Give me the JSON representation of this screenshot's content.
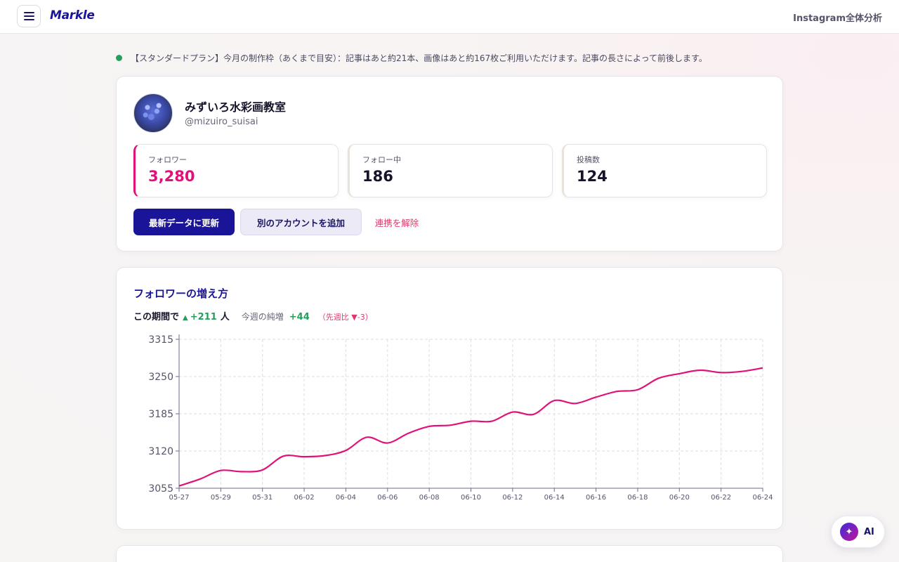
{
  "header": {
    "logo": "Markle",
    "right_title": "Instagram全体分析",
    "menu_icon": "hamburger-icon"
  },
  "notice": {
    "text": "【スタンダードプラン】今月の制作枠（あくまで目安）：記事はあと約21本、画像はあと約167枚ご利用いただけます。記事の長さによって前後します。",
    "status_color": "#22a05a"
  },
  "profile": {
    "name": "みずいろ水彩画教室",
    "handle": "@mizuiro_suisai",
    "stats": [
      {
        "label": "フォロワー",
        "value": "3,280"
      },
      {
        "label": "フォロー中",
        "value": "186"
      },
      {
        "label": "投稿数",
        "value": "124"
      }
    ],
    "buttons": {
      "refresh": "最新データに更新",
      "add_account": "別のアカウントを追加",
      "unlink": "連携を解除"
    }
  },
  "growth": {
    "title": "フォロワーの増え方",
    "period_label": "この期間で",
    "period_arrow": "▲",
    "period_amount": "+211",
    "period_unit": "人",
    "week_label": "今週の純増",
    "week_value": "+44",
    "compare": "（先週比 ▼-3）"
  },
  "colors": {
    "brand": "#1a1499",
    "accent": "#e0127a",
    "positive": "#22a05a",
    "negative": "#e0386a"
  },
  "chart_data": {
    "type": "line",
    "x": [
      "05-27",
      "05-28",
      "05-29",
      "05-30",
      "05-31",
      "06-01",
      "06-02",
      "06-03",
      "06-04",
      "06-05",
      "06-06",
      "06-07",
      "06-08",
      "06-09",
      "06-10",
      "06-11",
      "06-12",
      "06-13",
      "06-14",
      "06-15",
      "06-16",
      "06-17",
      "06-18",
      "06-19",
      "06-20",
      "06-21",
      "06-22",
      "06-23",
      "06-24"
    ],
    "x_tick_labels": [
      "05-27",
      "05-29",
      "05-31",
      "06-02",
      "06-04",
      "06-06",
      "06-08",
      "06-10",
      "06-12",
      "06-14",
      "06-16",
      "06-18",
      "06-20",
      "06-22",
      "06-24"
    ],
    "series": [
      {
        "values": [
          3059,
          3071,
          3086,
          3084,
          3087,
          3111,
          3110,
          3112,
          3121,
          3144,
          3134,
          3151,
          3163,
          3165,
          3172,
          3172,
          3188,
          3184,
          3208,
          3203,
          3214,
          3224,
          3227,
          3247,
          3255,
          3261,
          3257,
          3259,
          3265
        ]
      }
    ],
    "ylim": [
      3055,
      3315
    ],
    "yticks": [
      3055,
      3120,
      3185,
      3250,
      3315
    ],
    "grid": true,
    "line_color": "#e0127a"
  },
  "ai_button": {
    "label": "AI",
    "icon": "sparkle-icon"
  }
}
